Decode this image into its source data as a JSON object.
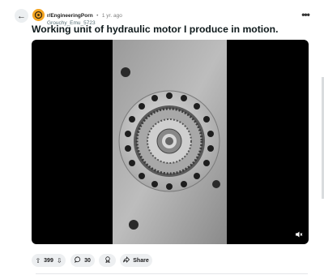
{
  "post": {
    "subreddit": "r/EngineeringPorn",
    "separator": "•",
    "time_ago": "1 yr. ago",
    "author": "Grouchy_Emu_5723",
    "title": "Working unit of hydraulic motor I produce in motion."
  },
  "actions": {
    "score": "399",
    "comments": "30",
    "share_label": "Share"
  },
  "icons": {
    "back": "arrow-left-icon",
    "more": "more-horizontal-icon",
    "upvote": "arrow-up-icon",
    "downvote": "arrow-down-icon",
    "comment": "comment-bubble-icon",
    "award": "award-icon",
    "share": "share-arrow-icon",
    "mute": "speaker-muted-icon"
  },
  "colors": {
    "avatar": "#f5a623",
    "pill_bg": "#edeff1",
    "media_bg": "#000000"
  }
}
